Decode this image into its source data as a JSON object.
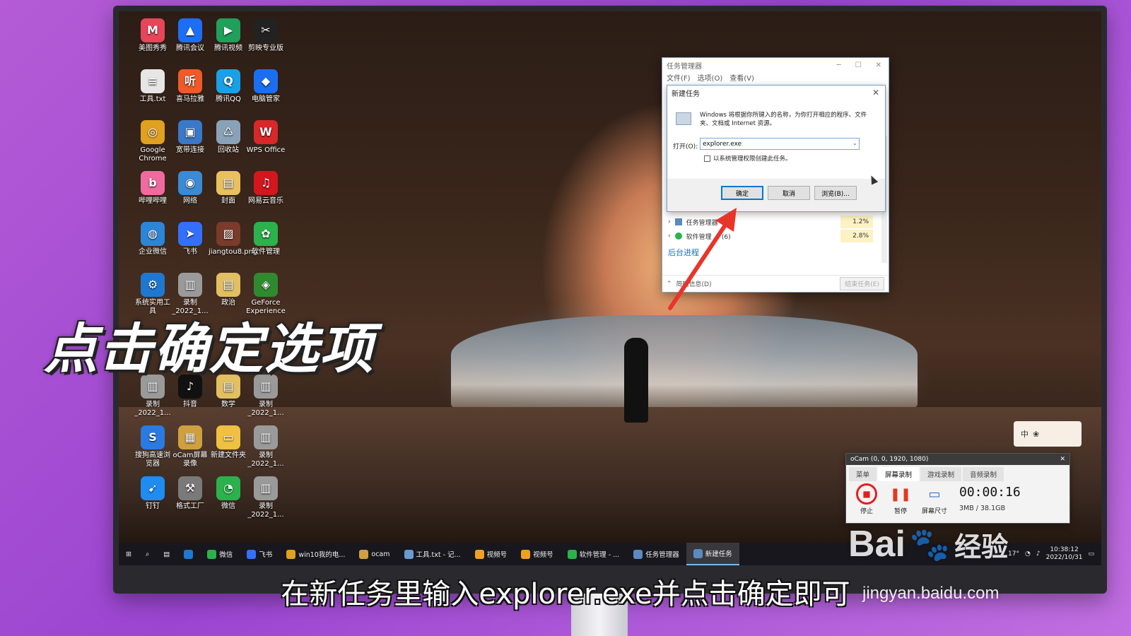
{
  "desktop": {
    "icons": [
      {
        "label": "美图秀秀",
        "color": "#e8455a",
        "glyph": "M"
      },
      {
        "label": "腾讯会议",
        "color": "#1e6ef5",
        "glyph": "▲"
      },
      {
        "label": "腾讯视频",
        "color": "#20a05a",
        "glyph": "▶"
      },
      {
        "label": "剪映专业版",
        "color": "#222222",
        "glyph": "✂"
      },
      {
        "label": "工具.txt",
        "color": "#e6e6e6",
        "glyph": "≡"
      },
      {
        "label": "喜马拉雅",
        "color": "#f05a28",
        "glyph": "听"
      },
      {
        "label": "腾讯QQ",
        "color": "#1aa0e6",
        "glyph": "Q"
      },
      {
        "label": "电脑管家",
        "color": "#1b6ef0",
        "glyph": "◆"
      },
      {
        "label": "Google Chrome",
        "color": "#e0a020",
        "glyph": "◎"
      },
      {
        "label": "宽带连接",
        "color": "#3a78c8",
        "glyph": "▣"
      },
      {
        "label": "回收站",
        "color": "#8aa2b8",
        "glyph": "♺"
      },
      {
        "label": "WPS Office",
        "color": "#d8282a",
        "glyph": "W"
      },
      {
        "label": "哔哩哔哩",
        "color": "#f06aa0",
        "glyph": "b"
      },
      {
        "label": "网络",
        "color": "#3a8ad6",
        "glyph": "◉"
      },
      {
        "label": "封面",
        "color": "#e8c060",
        "glyph": "▤"
      },
      {
        "label": "网易云音乐",
        "color": "#d4161e",
        "glyph": "♫"
      },
      {
        "label": "企业微信",
        "color": "#2b86d8",
        "glyph": "◍"
      },
      {
        "label": "飞书",
        "color": "#3370ff",
        "glyph": "➤"
      },
      {
        "label": "jiangtou8.png",
        "color": "#7a3b2b",
        "glyph": "▨"
      },
      {
        "label": "软件管理",
        "color": "#2bb24c",
        "glyph": "✿"
      },
      {
        "label": "系统实用工具",
        "color": "#1e78d2",
        "glyph": "⚙"
      },
      {
        "label": "录制_2022_1...",
        "color": "#9a9a9a",
        "glyph": "▥"
      },
      {
        "label": "政治",
        "color": "#e2c062",
        "glyph": "▤"
      },
      {
        "label": "GeForce Experience",
        "color": "#2f8a2f",
        "glyph": "◈"
      },
      {
        "label": "录制_2022_1...",
        "color": "#9a9a9a",
        "glyph": "▥"
      },
      {
        "label": "抖音",
        "color": "#111111",
        "glyph": "♪"
      },
      {
        "label": "数学",
        "color": "#e2c062",
        "glyph": "▤"
      },
      {
        "label": "录制_2022_1...",
        "color": "#9a9a9a",
        "glyph": "▥"
      },
      {
        "label": "搜狗高速浏览器",
        "color": "#2a7ae2",
        "glyph": "S"
      },
      {
        "label": "oCam屏幕录像",
        "color": "#d0a040",
        "glyph": "▦"
      },
      {
        "label": "新建文件夹",
        "color": "#f0c040",
        "glyph": "▭"
      },
      {
        "label": "录制_2022_1...",
        "color": "#9a9a9a",
        "glyph": "▥"
      },
      {
        "label": "钉钉",
        "color": "#1e8cf0",
        "glyph": "➹"
      },
      {
        "label": "格式工厂",
        "color": "#7a7a7a",
        "glyph": "⚒"
      },
      {
        "label": "微信",
        "color": "#2bb24c",
        "glyph": "◔"
      },
      {
        "label": "录制_2022_1...",
        "color": "#9a9a9a",
        "glyph": "▥"
      }
    ]
  },
  "caption": "点击确定选项",
  "subtitle": "在新任务里输入explorer.exe并点击确定即可",
  "taskmgr": {
    "title": "任务管理器",
    "menu": [
      "文件(F)",
      "选项(O)",
      "查看(V)"
    ],
    "rows": [
      {
        "label": "任务管理器",
        "value": "1.2%"
      },
      {
        "label": "软件管理 ... (6)",
        "value": "2.8%"
      }
    ],
    "section": "后台进程",
    "less_details": "简略信息(D)",
    "end_task": "结束任务(E)"
  },
  "new_task_dialog": {
    "title": "新建任务",
    "description": "Windows 将根据你所键入的名称，为你打开相应的程序、文件夹、文档或 Internet 资源。",
    "open_label": "打开(O):",
    "open_value": "explorer.exe",
    "admin_checkbox_label": "以系统管理权限创建此任务。",
    "ok": "确定",
    "cancel": "取消",
    "browse": "浏览(B)..."
  },
  "taskbar": {
    "items": [
      {
        "label": "微信",
        "color": "#2bb24c"
      },
      {
        "label": "飞书",
        "color": "#3370ff"
      },
      {
        "label": "win10我的电...",
        "color": "#e0a020"
      },
      {
        "label": "ocam",
        "color": "#d0a040"
      },
      {
        "label": "工具.txt - 记...",
        "color": "#6a9ad0"
      },
      {
        "label": "视频号",
        "color": "#f0a020"
      },
      {
        "label": "视频号",
        "color": "#f0a020"
      },
      {
        "label": "软件管理 - ...",
        "color": "#2bb24c"
      },
      {
        "label": "任务管理器",
        "color": "#5a8ac0"
      },
      {
        "label": "新建任务",
        "color": "#5a8ac0"
      }
    ],
    "active_index": 9,
    "tray_temp": "17°",
    "clock_time": "10:38:12",
    "clock_date": "2022/10/31"
  },
  "ime": {
    "label": "中"
  },
  "ocam": {
    "title": "oCam (0, 0, 1920, 1080)",
    "tabs": [
      "菜单",
      "屏幕录制",
      "游戏录制",
      "音频录制"
    ],
    "selected_tab": 1,
    "stop": "停止",
    "pause": "暂停",
    "screen": "屏幕尺寸",
    "timer": "00:00:16",
    "size": "3MB / 38.1GB"
  },
  "watermark": {
    "brand": "Bai",
    "brand2": "经验",
    "url": "jingyan.baidu.com"
  }
}
